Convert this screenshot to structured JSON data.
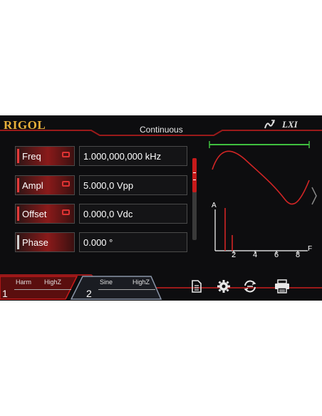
{
  "header": {
    "brand": "RIGOL",
    "mode": "Continuous",
    "lxi": "LXI"
  },
  "params": [
    {
      "label": "Freq",
      "value": "1.000,000,000 kHz",
      "active": true
    },
    {
      "label": "Ampl",
      "value": "5.000,0 Vpp",
      "active": true
    },
    {
      "label": "Offset",
      "value": "0.000,0 Vdc",
      "active": true
    },
    {
      "label": "Phase",
      "value": "0.000 °",
      "active": false
    }
  ],
  "harmonic_chart": {
    "y_label": "A",
    "x_label": "F",
    "x_ticks": [
      "2",
      "4",
      "6",
      "8"
    ]
  },
  "channels": [
    {
      "number": "1",
      "waveform": "Harm",
      "impedance": "HighZ"
    },
    {
      "number": "2",
      "waveform": "Sine",
      "impedance": "HighZ"
    }
  ],
  "colors": {
    "accent": "#c71a1a",
    "brand": "#e9b13a",
    "marker": "#3fbf3f"
  },
  "toolbar": {
    "icons": [
      "file-icon",
      "gear-icon",
      "sync-icon",
      "printer-icon"
    ]
  }
}
